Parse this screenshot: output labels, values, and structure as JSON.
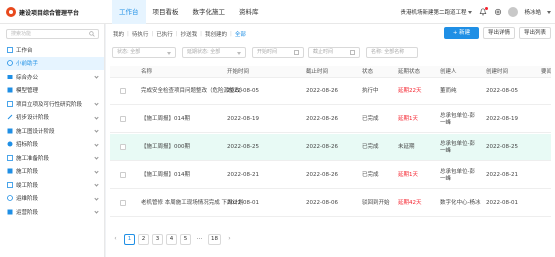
{
  "app": {
    "title": "建设项目综合管理平台",
    "brand_color": "#1f8fe5"
  },
  "top_nav": [
    {
      "label": "工作台",
      "active": true
    },
    {
      "label": "项目看板"
    },
    {
      "label": "数字化施工"
    },
    {
      "label": "资料库"
    }
  ],
  "header": {
    "project": "贵港机场新建第二跑道工程",
    "user": "杨冰皓",
    "icons": [
      "bell-icon",
      "gear-icon",
      "avatar"
    ]
  },
  "sidebar": {
    "search_placeholder": "搜索功能",
    "items": [
      {
        "label": "工作台",
        "icon": "desk-icon"
      },
      {
        "label": "小前助手",
        "icon": "assistant-icon",
        "active": true
      },
      {
        "label": "综合办公",
        "icon": "office-icon"
      },
      {
        "label": "模型管理",
        "icon": "model-icon"
      },
      {
        "label": "项目立项及可行性研究阶段",
        "icon": "project-icon"
      },
      {
        "label": "初步设计阶段",
        "icon": "design-icon"
      },
      {
        "label": "施工图设计阶段",
        "icon": "drawing-icon"
      },
      {
        "label": "招标阶段",
        "icon": "bid-icon"
      },
      {
        "label": "施工准备阶段",
        "icon": "prep-icon"
      },
      {
        "label": "施工阶段",
        "icon": "build-icon"
      },
      {
        "label": "竣工阶段",
        "icon": "finish-icon"
      },
      {
        "label": "运维阶段",
        "icon": "ops-icon"
      },
      {
        "label": "运营阶段",
        "icon": "operate-icon"
      }
    ]
  },
  "tabs": [
    "我的",
    "待执行",
    "已执行",
    "抄送我",
    "我创建的",
    "全部"
  ],
  "active_tab": "全部",
  "actions": {
    "new": "+ 新建",
    "export_detail": "导出详情",
    "export_list": "导出列表"
  },
  "filters": {
    "status_placeholder": "状态: 全部",
    "delay_placeholder": "延期状态: 全部",
    "start_placeholder": "开始时间",
    "end_placeholder": "截止时间",
    "name_placeholder": "名称: 全部名称"
  },
  "table": {
    "columns": [
      "名称",
      "开始时间",
      "截止时间",
      "状态",
      "延期状态",
      "创建人",
      "创建时间",
      "要闻"
    ],
    "rows": [
      {
        "name": "完成安全检查项目问题整改（危险源整改）",
        "start": "2022-08-05",
        "end": "2022-08-26",
        "status": "执行中",
        "delay": "延期22天",
        "creator": "董而纯",
        "created": "2022-08-05"
      },
      {
        "name": "【施工周报】014期",
        "start": "2022-08-19",
        "end": "2022-08-26",
        "status": "已完成",
        "delay": "延期1天",
        "creator": "总承包单位-彭一峰",
        "created": "2022-08-19"
      },
      {
        "name": "【施工周报】000期",
        "start": "2022-08-25",
        "end": "2022-08-26",
        "status": "已完成",
        "delay": "未延期",
        "creator": "总承包单位-彭一峰",
        "created": "2022-08-25"
      },
      {
        "name": "【施工周报】014期",
        "start": "2022-08-21",
        "end": "2022-08-26",
        "status": "已完成",
        "delay": "延期1天",
        "creator": "总承包单位-彭一峰",
        "created": "2022-08-21"
      },
      {
        "name": "老机管修 本周施工现场情况完成 下周计划",
        "start": "2022-08-01",
        "end": "2022-08-06",
        "status": "驳回到开始",
        "delay": "延期42天",
        "creator": "数字化中心-杨冰",
        "created": "2022-08-01"
      }
    ],
    "highlighted_row": 2
  },
  "pagination": {
    "pages": [
      "1",
      "2",
      "3",
      "4",
      "5",
      "...",
      "18"
    ],
    "current": "1"
  }
}
